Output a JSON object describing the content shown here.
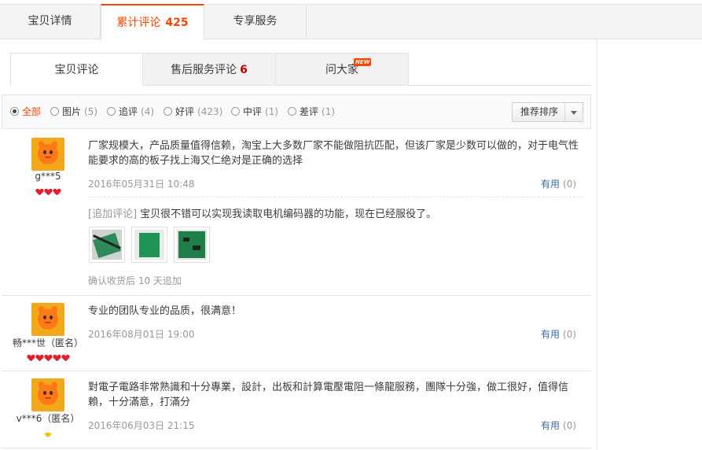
{
  "top_tabs": {
    "details": "宝贝详情",
    "reviews": "累计评论",
    "reviews_count": "425",
    "service": "专享服务"
  },
  "inner_tabs": {
    "item_reviews": "宝贝评论",
    "after_sale": "售后服务评论",
    "after_sale_count": "6",
    "ask": "问大家",
    "ask_badge": "NEW"
  },
  "filters": [
    {
      "label": "全部",
      "count": ""
    },
    {
      "label": "图片",
      "count": "(5)"
    },
    {
      "label": "追评",
      "count": "(4)"
    },
    {
      "label": "好评",
      "count": "(423)"
    },
    {
      "label": "中评",
      "count": "(1)"
    },
    {
      "label": "差评",
      "count": "(1)"
    }
  ],
  "sort": {
    "label": "推荐排序"
  },
  "reviews": [
    {
      "user": "g***5",
      "rank_hearts": 3,
      "text": "厂家规模大，产品质量值得信赖，淘宝上大多数厂家不能做阻抗匹配，但该厂家是少数可以做的，对于电气性能要求的高的板子找上海又仁绝对是正确的选择",
      "date": "2016年05月31日 10:48",
      "useful_label": "有用",
      "useful_count": "(0)",
      "append_tag": "[追加评论]",
      "append_text": "宝贝很不错可以实现我读取电机编码器的功能，现在已经服役了。",
      "photos": [
        "photo-1",
        "photo-2",
        "photo-3"
      ],
      "append_note": "确认收货后 10 天追加"
    },
    {
      "user": "畅***世（匿名）",
      "rank_hearts": 5,
      "text": "专业的团队专业的品质，很满意！",
      "date": "2016年08月01日 19:00",
      "useful_label": "有用",
      "useful_count": "(0)"
    },
    {
      "user": "v***6（匿名）",
      "rank_diamonds": 1,
      "text": "對電子電路非常熟識和十分專業，設計，出板和計算電壓電阻一條龍服務，團隊十分強，做工很好，值得信賴，十分滿意，打滿分",
      "date": "2016年06月03日 21:15",
      "useful_label": "有用",
      "useful_count": "(0)"
    }
  ],
  "colors": {
    "accent": "#ff4400",
    "link": "#3e6aa8",
    "count_red": "#c40000",
    "muted": "#999999"
  }
}
